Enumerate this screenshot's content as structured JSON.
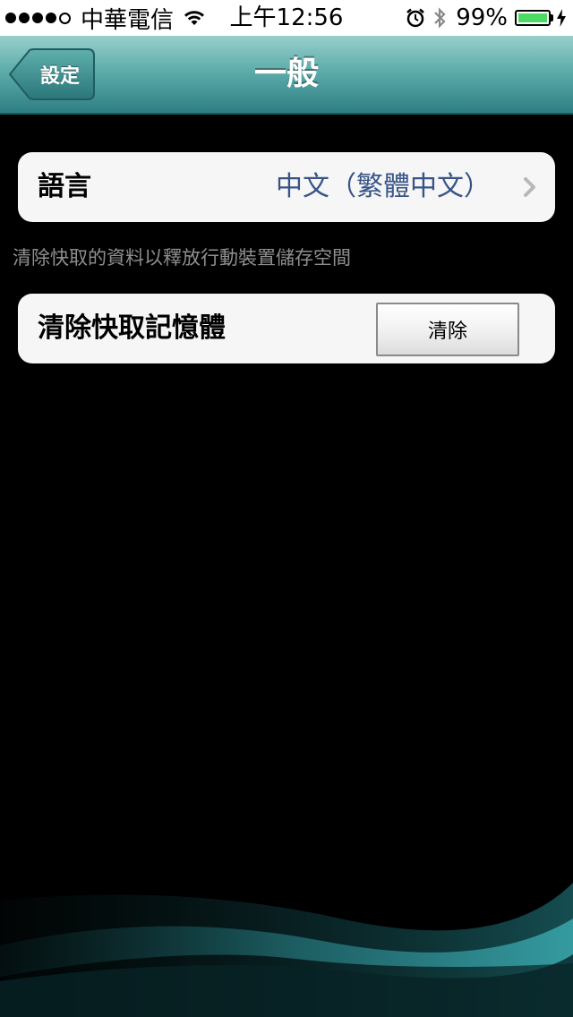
{
  "status_bar": {
    "carrier": "中華電信",
    "time": "上午12:56",
    "battery_percent": "99%",
    "battery_level": 0.99,
    "signal_bars_filled": 4,
    "signal_bars_total": 5
  },
  "nav": {
    "back_label": "設定",
    "title": "一般"
  },
  "language": {
    "label": "語言",
    "value": "中文（繁體中文）"
  },
  "cache": {
    "note": "清除快取的資料以釋放行動裝置儲存空間",
    "label": "清除快取記憶體",
    "button_label": "清除"
  },
  "icons": {
    "wifi": "wifi-icon",
    "alarm": "alarm-icon",
    "bluetooth": "bluetooth-icon",
    "battery": "battery-icon",
    "charging": "charging-bolt-icon",
    "back": "back-arrow-button",
    "chevron": "chevron-right-icon"
  },
  "colors": {
    "nav_top": "#97cfcc",
    "nav_bottom": "#2e7f84",
    "value_blue": "#385487",
    "battery_green": "#4cd964"
  }
}
